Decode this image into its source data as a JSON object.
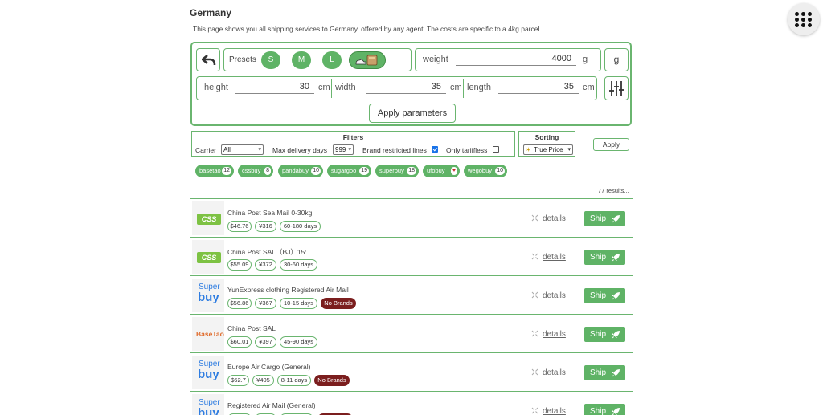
{
  "page": {
    "title": "Germany",
    "description": "This page shows you all shipping services to Germany, offered by any agent. The costs are specific to a 4kg parcel."
  },
  "params": {
    "presets_label": "Presets",
    "presets": [
      "S",
      "M",
      "L"
    ],
    "weight_label": "weight",
    "weight_value": "4000",
    "weight_unit": "g",
    "unit_toggle": "g",
    "height_label": "height",
    "height_value": "30",
    "width_label": "width",
    "width_value": "35",
    "length_label": "length",
    "length_value": "35",
    "dim_unit": "cm",
    "apply_label": "Apply parameters"
  },
  "filters": {
    "title": "Filters",
    "carrier_label": "Carrier",
    "carrier_value": "All",
    "max_delivery_label": "Max delivery days",
    "max_delivery_value": "999",
    "brand_label": "Brand restricted lines",
    "brand_checked": true,
    "tariff_label": "Only tariffless",
    "tariff_checked": false
  },
  "sorting": {
    "title": "Sorting",
    "value": "True Price"
  },
  "apply_label": "Apply",
  "agents": [
    {
      "name": "basetao",
      "count": "12"
    },
    {
      "name": "cssbuy",
      "count": "8"
    },
    {
      "name": "pandabuy",
      "count": "10"
    },
    {
      "name": "sugargoo",
      "count": "19"
    },
    {
      "name": "superbuy",
      "count": "18"
    },
    {
      "name": "ufobuy",
      "count": "♥"
    },
    {
      "name": "wegobuy",
      "count": "10"
    }
  ],
  "results_count": "77 results...",
  "logos": {
    "css": "CSS",
    "super": "Super",
    "buy": "buy",
    "basetao": "BaseTao",
    "basetao_sub": "·······"
  },
  "row_actions": {
    "details": "details",
    "ship": "Ship"
  },
  "colors": {
    "accent": "#5fb366",
    "brand_badge": "#7b1e1e",
    "superbuy_blue": "#2f7de1",
    "cssbuy_green": "#7dc243",
    "basetao_orange": "#e06b2b"
  },
  "results": [
    {
      "logo": "cssbuy",
      "name": "China Post Sea Mail 0-30kg",
      "usd": "$46.76",
      "cny": "¥316",
      "days": "60-180 days",
      "brand": ""
    },
    {
      "logo": "cssbuy",
      "name": "China Post SAL（BJ）15:",
      "usd": "$55.09",
      "cny": "¥372",
      "days": "30-60 days",
      "brand": ""
    },
    {
      "logo": "superbuy",
      "name": "YunExpress clothing Registered Air Mail",
      "usd": "$56.86",
      "cny": "¥367",
      "days": "10-15 days",
      "brand": "No Brands"
    },
    {
      "logo": "basetao",
      "name": "China Post SAL",
      "usd": "$60.01",
      "cny": "¥397",
      "days": "45-90 days",
      "brand": ""
    },
    {
      "logo": "superbuy",
      "name": "Europe Air Cargo (General)",
      "usd": "$62.7",
      "cny": "¥405",
      "days": "8-11 days",
      "brand": "No Brands"
    },
    {
      "logo": "superbuy",
      "name": "Registered Air Mail (General)",
      "usd": "",
      "cny": "",
      "days": "",
      "brand": ""
    }
  ]
}
